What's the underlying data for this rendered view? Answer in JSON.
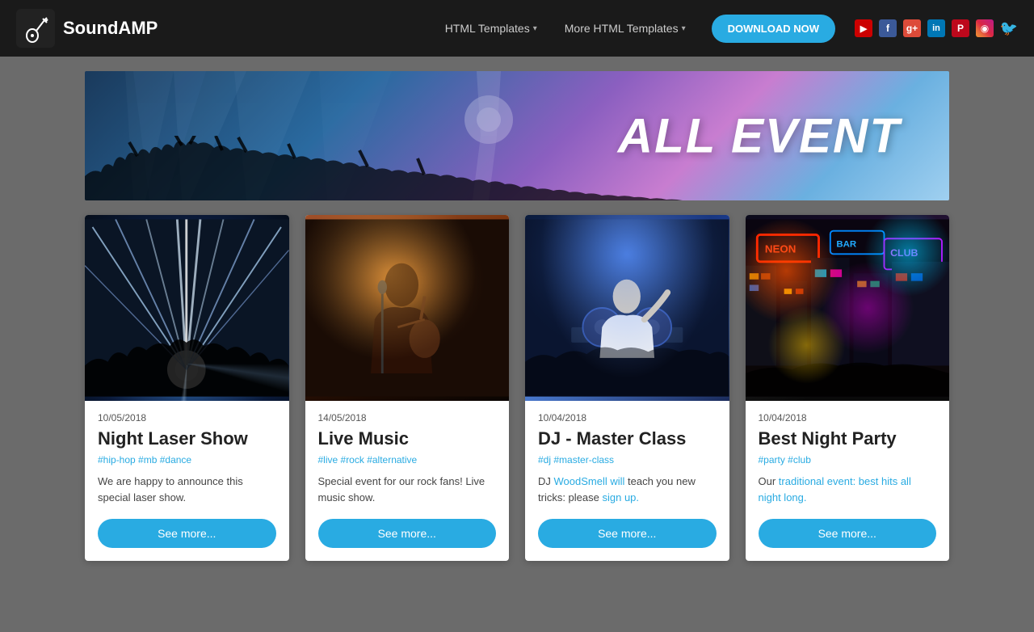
{
  "brand": {
    "name": "SoundAMP"
  },
  "navbar": {
    "nav1_label": "HTML Templates",
    "nav2_label": "More HTML Templates",
    "download_label": "DOWNLOAD NOW"
  },
  "hero": {
    "title": "ALL EVENT"
  },
  "cards": [
    {
      "date": "10/05/2018",
      "title": "Night Laser Show",
      "tags": "#hip-hop #mb #dance",
      "description": "We are happy to announce this special laser show.",
      "button": "See more...",
      "image_type": "laser"
    },
    {
      "date": "14/05/2018",
      "title": "Live Music",
      "tags": "#live #rock #alternative",
      "description": "Special event for our rock fans! Live music show.",
      "button": "See more...",
      "image_type": "music"
    },
    {
      "date": "10/04/2018",
      "title": "DJ - Master Class",
      "tags": "#dj #master-class",
      "description": "DJ WoodSmell will teach you new tricks: please sign up.",
      "button": "See more...",
      "image_type": "dj"
    },
    {
      "date": "10/04/2018",
      "title": "Best Night Party",
      "tags": "#party #club",
      "description": "Our traditional event: best hits all night long.",
      "button": "See more...",
      "image_type": "party"
    }
  ],
  "social": {
    "youtube": "▶",
    "facebook": "f",
    "google": "g+",
    "linkedin": "in",
    "pinterest": "P",
    "instagram": "📷",
    "twitter": "🐦"
  }
}
